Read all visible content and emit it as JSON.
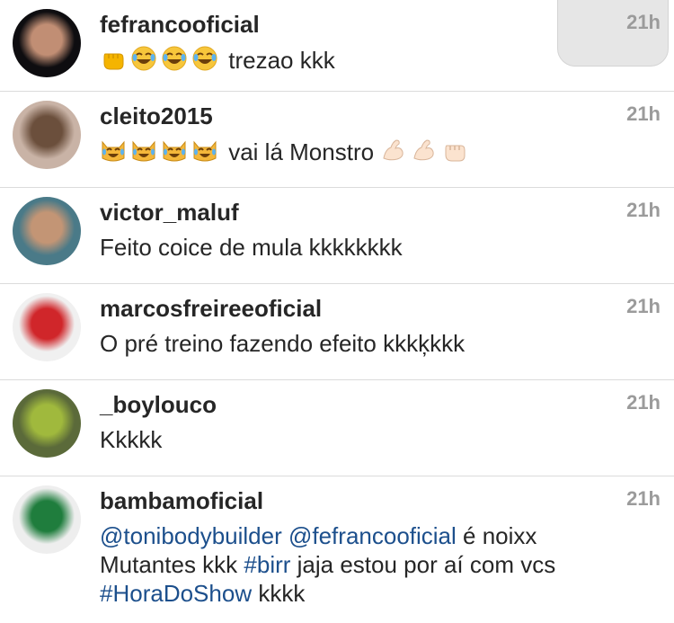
{
  "comments": [
    {
      "username": "fefrancooficial",
      "time": "21h",
      "parts": [
        {
          "emoji": "fist"
        },
        {
          "emoji": "joy"
        },
        {
          "emoji": "joy"
        },
        {
          "emoji": "joy"
        },
        {
          "text": " trezao kkk"
        }
      ],
      "avatar_colors": [
        "#0e0d10",
        "#c18e74"
      ]
    },
    {
      "username": "cleito2015",
      "time": "21h",
      "parts": [
        {
          "emoji": "catjoy"
        },
        {
          "emoji": "catjoy"
        },
        {
          "emoji": "catjoy"
        },
        {
          "emoji": "catjoy"
        },
        {
          "text": " vai lá Monstro "
        },
        {
          "emoji": "muscle"
        },
        {
          "emoji": "muscle"
        },
        {
          "emoji": "fistlight"
        }
      ],
      "avatar_colors": [
        "#c9b3a6",
        "#6b4f3c"
      ]
    },
    {
      "username": "victor_maluf",
      "time": "21h",
      "parts": [
        {
          "text": "Feito coice de mula kkkkkkkk"
        }
      ],
      "avatar_colors": [
        "#4a7a88",
        "#c39575"
      ]
    },
    {
      "username": "marcosfreireeoficial",
      "time": "21h",
      "parts": [
        {
          "text": "O pré treino fazendo efeito kkkķkkk"
        }
      ],
      "avatar_colors": [
        "#f0f0f0",
        "#d0262a"
      ]
    },
    {
      "username": "_boylouco",
      "time": "21h",
      "parts": [
        {
          "text": "Kkkkk"
        }
      ],
      "avatar_colors": [
        "#5b6a3a",
        "#a0b93d"
      ]
    },
    {
      "username": "bambamoficial",
      "time": "21h",
      "lines": [
        [
          {
            "mention": "@tonibodybuilder"
          },
          {
            "text": " "
          },
          {
            "mention": "@fefrancooficial"
          },
          {
            "text": " é noixx"
          }
        ],
        [
          {
            "text": "Mutantes kkk "
          },
          {
            "mention": "#birr"
          },
          {
            "text": " jaja estou por aí com vcs"
          }
        ],
        [
          {
            "mention": "#HoraDoShow"
          },
          {
            "text": " kkkk"
          }
        ]
      ],
      "avatar_colors": [
        "#eeeeee",
        "#1f7d3d"
      ]
    }
  ]
}
